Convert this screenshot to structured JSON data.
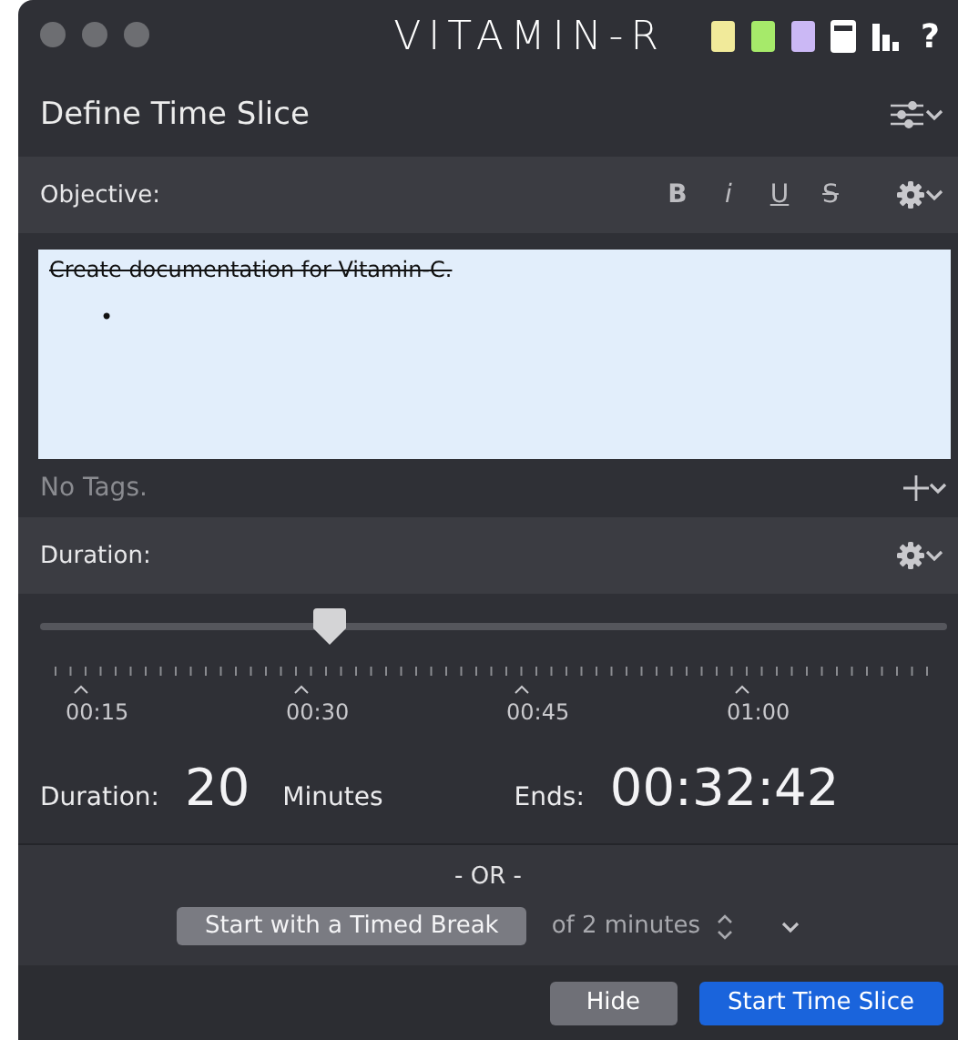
{
  "window": {
    "logo": "VITAMIN-R",
    "help": "?",
    "toolbar_icons": [
      {
        "kind": "note",
        "color": "#f1ea9a"
      },
      {
        "kind": "note",
        "color": "#a6ea6a"
      },
      {
        "kind": "note",
        "color": "#cbb8f5"
      },
      {
        "kind": "calculator"
      },
      {
        "kind": "chart"
      }
    ]
  },
  "header": {
    "title": "Define Time Slice"
  },
  "objective": {
    "label": "Objective:",
    "format_buttons": [
      {
        "kind": "bold",
        "label": "B"
      },
      {
        "kind": "italic",
        "label": "i"
      },
      {
        "kind": "underline",
        "label": "U"
      },
      {
        "kind": "strike",
        "label": "S"
      }
    ],
    "text": "Create documentation for Vitamin-C.",
    "struck": true,
    "list_bullet": "•",
    "tags": "No Tags."
  },
  "duration": {
    "label": "Duration:",
    "slider": {
      "level": 0.32,
      "labels": [
        "00:15",
        "00:30",
        "00:45",
        "01:00"
      ]
    },
    "duration_label": "Duration:",
    "value": "20",
    "unit": "Minutes",
    "ends_label": "Ends:",
    "ends": "00:32:42"
  },
  "break": {
    "separator": "- OR -",
    "button": "Start with a Timed Break",
    "length": "of 2 minutes"
  },
  "footer": {
    "buttons": [
      {
        "label": "Hide",
        "primary": false
      },
      {
        "label": "Start Time Slice",
        "primary": true
      }
    ]
  }
}
